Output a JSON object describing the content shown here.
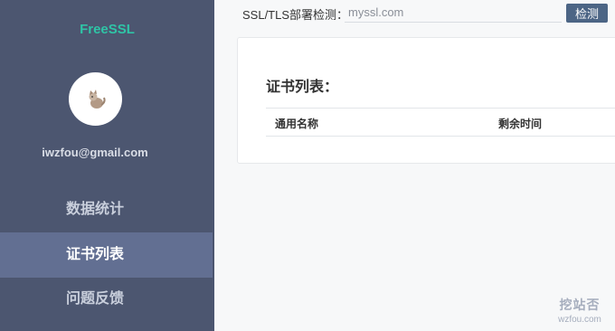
{
  "sidebar": {
    "brand": "FreeSSL",
    "email": "iwzfou@gmail.com",
    "items": [
      {
        "label": "数据统计",
        "active": false
      },
      {
        "label": "证书列表",
        "active": true
      },
      {
        "label": "问题反馈",
        "active": false
      }
    ]
  },
  "detect": {
    "label": "SSL/TLS部署检测：",
    "placeholder": "myssl.com",
    "button_label": "检测"
  },
  "main": {
    "title": "证书列表：",
    "table": {
      "columns": [
        "通用名称",
        "剩余时间"
      ]
    }
  },
  "watermark": {
    "name": "挖站否",
    "domain": "wzfou.com"
  },
  "colors": {
    "sidebar_bg": "#4c5670",
    "sidebar_active": "#626f92",
    "brand": "#2fc4a6",
    "button": "#4c6585"
  }
}
